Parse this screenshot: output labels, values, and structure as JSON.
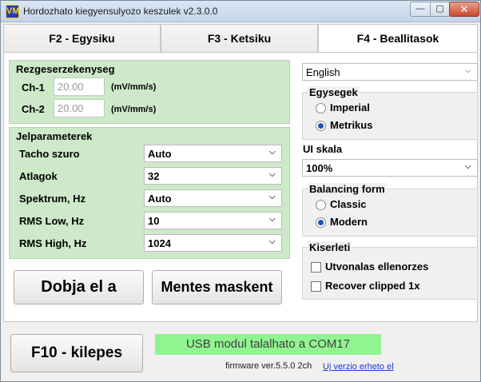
{
  "window": {
    "title": "Hordozhato kiegyensulyozo keszulek v2.3.0.0",
    "icon_letters": "VM",
    "minimize_glyph": "—",
    "maximize_glyph": "▢",
    "close_glyph": "✕"
  },
  "tabs": [
    {
      "label": "F2 - Egysiku",
      "active": false
    },
    {
      "label": "F3 - Ketsiku",
      "active": false
    },
    {
      "label": "F4 - Beallitasok",
      "active": true
    }
  ],
  "sensitivity": {
    "title": "Rezgeserzekenyseg",
    "ch1_label": "Ch-1",
    "ch1_value": "20.00",
    "ch1_unit": "(mV/mm/s)",
    "ch2_label": "Ch-2",
    "ch2_value": "20.00",
    "ch2_unit": "(mV/mm/s)"
  },
  "signal": {
    "title": "Jelparameterek",
    "rows": [
      {
        "label": "Tacho szuro",
        "value": "Auto"
      },
      {
        "label": "Atlagok",
        "value": "32"
      },
      {
        "label": "Spektrum, Hz",
        "value": "Auto"
      },
      {
        "label": "RMS Low, Hz",
        "value": "10"
      },
      {
        "label": "RMS High, Hz",
        "value": "1024"
      }
    ]
  },
  "buttons": {
    "reset": "Dobja el a",
    "save_as": "Mentes maskent",
    "exit": "F10 - kilepes"
  },
  "language": {
    "value": "English"
  },
  "units": {
    "title": "Egysegek",
    "options": [
      {
        "label": "Imperial",
        "selected": false
      },
      {
        "label": "Metrikus",
        "selected": true
      }
    ]
  },
  "ui_scale": {
    "title": "UI skala",
    "value": "100%"
  },
  "balancing_form": {
    "title": "Balancing form",
    "options": [
      {
        "label": "Classic",
        "selected": false
      },
      {
        "label": "Modern",
        "selected": true
      }
    ]
  },
  "experimental": {
    "title": "Kiserleti",
    "options": [
      {
        "label": "Utvonalas ellenorzes",
        "checked": false
      },
      {
        "label": "Recover clipped 1x",
        "checked": false
      }
    ]
  },
  "status": {
    "message": "USB modul talalhato a COM17",
    "firmware": "firmware ver.5.5.0 2ch",
    "update_link": "Uj verzio erheto el"
  },
  "colors": {
    "group_bg": "#cde9c9",
    "status_bg": "#90f490",
    "radio_dot": "#1f55b8",
    "link": "#1a36d6"
  },
  "icons": {
    "dropdown": "chevron-down-icon"
  }
}
